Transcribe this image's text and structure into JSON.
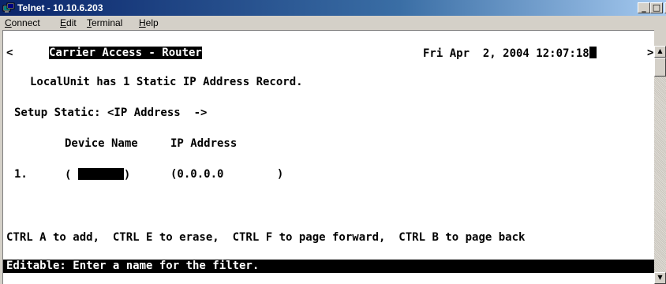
{
  "window": {
    "title": "Telnet - 10.10.6.203",
    "icon": "telnet-app-icon",
    "controls": [
      "minimize-icon",
      "maximize-icon",
      "close-icon"
    ]
  },
  "menu": {
    "connect": {
      "first": "C",
      "rest": "onnect"
    },
    "edit": {
      "first": "E",
      "rest": "dit"
    },
    "terminal": {
      "first": "T",
      "rest": "erminal"
    },
    "help": {
      "first": "H",
      "rest": "elp"
    }
  },
  "terminal": {
    "left_marker": "<",
    "right_marker": ">",
    "header_title": "Carrier Access - Router",
    "datetime": "Fri Apr  2, 2004 12:07:18",
    "record_info": "LocalUnit has 1 Static IP Address Record.",
    "setup_line": "Setup Static: <IP Address  ->",
    "col_device_name": "Device Name",
    "col_ip_address": "IP Address",
    "row_number": "1.",
    "row_name_open": "(",
    "row_name_close": ")",
    "row_ip": "(0.0.0.0        )",
    "shortcuts": "CTRL A to add,  CTRL E to erase,  CTRL F to page forward,  CTRL B to page back",
    "status": "Editable: Enter a name for the filter."
  },
  "colors": {
    "titlebar_start": "#0a246a",
    "titlebar_end": "#a6caf0",
    "terminal_bg": "#ffffff",
    "terminal_fg": "#000000"
  }
}
